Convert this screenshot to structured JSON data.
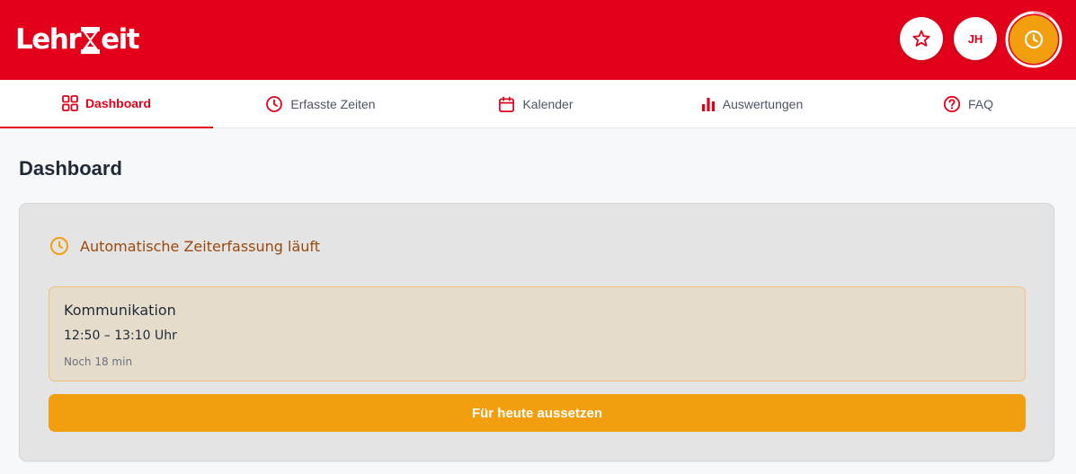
{
  "header": {
    "logo_left": "Lehr",
    "logo_right": "eit",
    "avatar_initials": "JH",
    "colors": {
      "brand": "#e2001a",
      "accent": "#f29f0f"
    },
    "icons": [
      "star-icon",
      "clock-icon"
    ]
  },
  "tabs": [
    {
      "label": "Dashboard",
      "icon": "dashboard-icon",
      "active": true
    },
    {
      "label": "Erfasste Zeiten",
      "icon": "clock-icon",
      "active": false
    },
    {
      "label": "Kalender",
      "icon": "calendar-icon",
      "active": false
    },
    {
      "label": "Auswertungen",
      "icon": "bar-chart-icon",
      "active": false
    },
    {
      "label": "FAQ",
      "icon": "help-icon",
      "active": false
    }
  ],
  "page": {
    "title": "Dashboard"
  },
  "tracking": {
    "status": "Automatische Zeiterfassung läuft",
    "activity": "Kommunikation",
    "time_range": "12:50 – 13:10 Uhr",
    "remaining": "Noch 18 min",
    "pause_label": "Für heute aussetzen"
  }
}
